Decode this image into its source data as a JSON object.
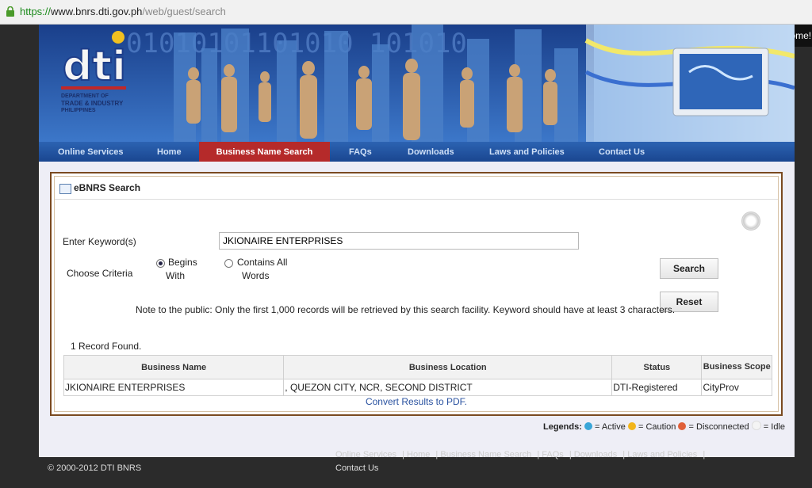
{
  "browser": {
    "url_scheme": "https://",
    "url_host": "www.bnrs.dti.gov.ph",
    "url_path": "/web/guest/search"
  },
  "header": {
    "welcome": "Welcome!",
    "logo_text": "dti",
    "logo_sub1": "DEPARTMENT OF",
    "logo_sub2": "TRADE & INDUSTRY",
    "logo_sub3": "PHILIPPINES"
  },
  "nav": {
    "items": [
      {
        "label": "Online Services"
      },
      {
        "label": "Home"
      },
      {
        "label": "Business Name Search"
      },
      {
        "label": "FAQs"
      },
      {
        "label": "Downloads"
      },
      {
        "label": "Laws and Policies"
      },
      {
        "label": "Contact Us"
      }
    ]
  },
  "search": {
    "title": "eBNRS Search",
    "keyword_label": "Enter Keyword(s)",
    "keyword_value": "JKIONAIRE ENTERPRISES",
    "criteria_label": "Choose Criteria",
    "option1_line1": "Begins",
    "option1_line2": "With",
    "option2_line1": "Contains All",
    "option2_line2": "Words",
    "search_button": "Search",
    "reset_button": "Reset",
    "note": "Note to the public: Only the first 1,000 records will be retrieved by this search facility. Keyword should have at least 3 characters."
  },
  "results": {
    "count_text": "1 Record Found.",
    "headers": {
      "name": "Business Name",
      "location": "Business Location",
      "status": "Status",
      "scope": "Business Scope"
    },
    "rows": [
      {
        "name": "JKIONAIRE ENTERPRISES",
        "location": ", QUEZON CITY, NCR, SECOND DISTRICT",
        "status": "DTI-Registered",
        "scope": "CityProv"
      }
    ],
    "pdf_link": "Convert Results to PDF."
  },
  "legends": {
    "label": "Legends:",
    "active": "= Active",
    "caution": "= Caution",
    "disconnected": "= Disconnected",
    "idle": "= Idle",
    "colors": {
      "active": "#3aa6d8",
      "caution": "#f2b51c",
      "disconnected": "#e0603a",
      "idle": "#f4f4f4"
    }
  },
  "footer": {
    "copyright": "© 2000-2012 DTI BNRS",
    "links": [
      "Online Services",
      "Home",
      "Business Name Search",
      "FAQs",
      "Downloads",
      "Laws and Policies"
    ],
    "contact": "Contact Us"
  }
}
